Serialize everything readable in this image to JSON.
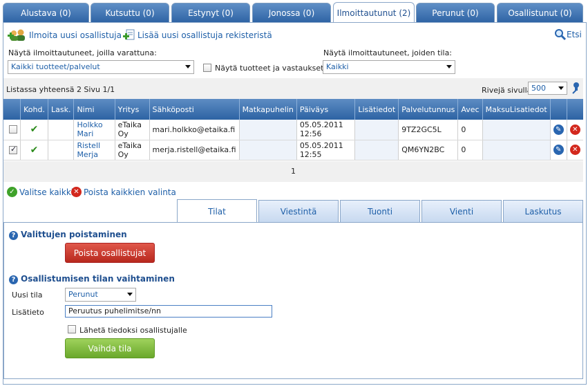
{
  "tabs": [
    {
      "label": "Alustava (0)"
    },
    {
      "label": "Kutsuttu (0)"
    },
    {
      "label": "Estynyt (0)"
    },
    {
      "label": "Jonossa (0)"
    },
    {
      "label": "Ilmoittautunut (2)"
    },
    {
      "label": "Perunut (0)"
    },
    {
      "label": "Osallistunut (0)"
    }
  ],
  "toolbar": {
    "add_participant": "Ilmoita uusi osallistuja",
    "add_from_registry": "Lisää uusi osallistuja rekisteristä",
    "search": "Etsi"
  },
  "filters": {
    "products_label": "Näytä ilmoittautuneet, joilla varattuna:",
    "products_value": "Kaikki tuotteet/palvelut",
    "show_products_answers": "Näytä tuotteet ja vastaukset",
    "status_label": "Näytä ilmoittautuneet, joiden tila:",
    "status_value": "Kaikki"
  },
  "list": {
    "summary": "Listassa yhteensä 2 Sivu 1/1",
    "rows_per_page_label": "Rivejä sivulla",
    "rows_per_page_value": "500"
  },
  "table": {
    "headers": [
      "Kohd.",
      "Lask.",
      "Nimi",
      "Yritys",
      "Sähköposti",
      "Matkapuhelin",
      "Päiväys",
      "Lisätiedot",
      "Palvelutunnus",
      "Avec",
      "MaksuLisatiedot"
    ],
    "rows": [
      {
        "name": "Holkko Mari",
        "company": "eTaika Oy",
        "email": "mari.holkko@etaika.fi",
        "mobile": "",
        "date": "05.05.2011 12:56",
        "info": "",
        "code": "9TZ2GC5L",
        "avec": "0",
        "payinfo": "",
        "checked": false
      },
      {
        "name": "Ristell Merja",
        "company": "eTaika Oy",
        "email": "merja.ristell@etaika.fi",
        "mobile": "",
        "date": "05.05.2011 12:55",
        "info": "",
        "code": "QM6YN2BC",
        "avec": "0",
        "payinfo": "",
        "checked": true
      }
    ],
    "page": "1"
  },
  "selection": {
    "select_all": "Valitse kaikki",
    "clear_all": "Poista kaikkien valinta"
  },
  "subtabs": [
    {
      "label": "Tilat"
    },
    {
      "label": "Viestintä"
    },
    {
      "label": "Tuonti"
    },
    {
      "label": "Vienti"
    },
    {
      "label": "Laskutus"
    }
  ],
  "remove_section": {
    "title": "Valittujen poistaminen",
    "button": "Poista osallistujat"
  },
  "status_section": {
    "title": "Osallistumisen tilan vaihtaminen",
    "new_status_label": "Uusi tila",
    "new_status_value": "Perunut",
    "info_label": "Lisätieto",
    "info_value": "Peruutus puhelimitse/nn",
    "notify_label": "Lähetä tiedoksi osallistujalle",
    "button": "Vaihda tila"
  },
  "colors": {
    "tab_blue": "#2f64a5",
    "link_blue": "#1e5fa8",
    "danger_red": "#b8281d",
    "success_green": "#6aa82b"
  }
}
